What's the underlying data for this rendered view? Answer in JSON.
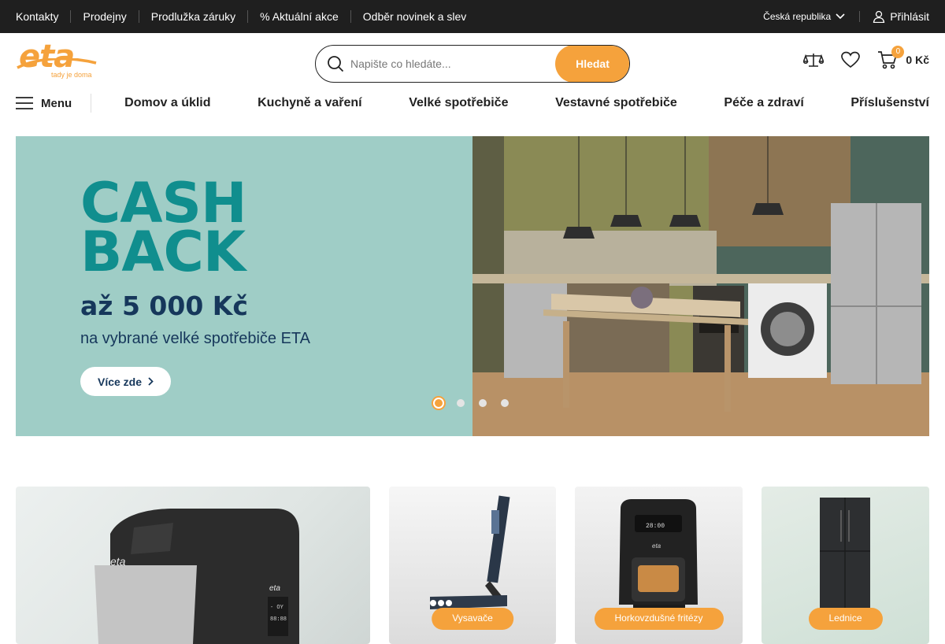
{
  "topbar": {
    "links": [
      "Kontakty",
      "Prodejny",
      "Prodlužka záruky",
      "% Aktuální akce",
      "Odběr novinek a slev"
    ],
    "country": "Česká republika",
    "login": "Přihlásit"
  },
  "header": {
    "logo_text": "eta",
    "logo_tagline": "tady je doma",
    "search_placeholder": "Napište co hledáte...",
    "search_button": "Hledat",
    "cart_count": "0",
    "cart_total": "0 Kč"
  },
  "nav": {
    "menu_label": "Menu",
    "categories": [
      "Domov a úklid",
      "Kuchyně a vaření",
      "Velké spotřebiče",
      "Vestavné spotřebiče",
      "Péče a zdraví",
      "Příslušenství"
    ]
  },
  "hero": {
    "line1": "CASH",
    "line2": "BACK",
    "amount": "až 5 000 Kč",
    "subtitle": "na vybrané velké spotřebiče ETA",
    "button": "Více zde",
    "slides": 4,
    "active_slide": 1
  },
  "tiles": [
    {
      "label": ""
    },
    {
      "label": "Vysavače"
    },
    {
      "label": "Horkovzdušné fritézy"
    },
    {
      "label": "Lednice"
    }
  ],
  "colors": {
    "accent": "#f5a23c",
    "topbar_bg": "#1f1f1f",
    "hero_bg": "#9fcdc6",
    "hero_teal": "#108e8e",
    "hero_navy": "#16375b"
  }
}
